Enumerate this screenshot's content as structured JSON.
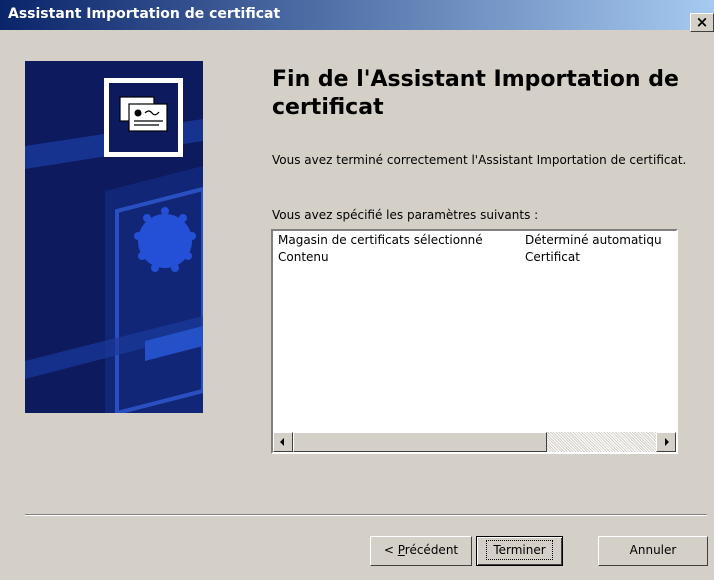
{
  "window": {
    "title": "Assistant Importation de certificat",
    "close_label": "×"
  },
  "content": {
    "heading": "Fin de l'Assistant Importation de certificat",
    "description": "Vous avez terminé correctement l'Assistant Importation de certificat.",
    "params_label": "Vous avez spécifié les paramètres suivants :"
  },
  "settings_list": {
    "rows": [
      {
        "name": "Magasin de certificats sélectionné",
        "value": "Déterminé automatiqu"
      },
      {
        "name": "Contenu",
        "value": "Certificat"
      }
    ]
  },
  "buttons": {
    "back_prefix": "< ",
    "back_mnemonic": "P",
    "back_rest": "récédent",
    "finish": "Terminer",
    "cancel": "Annuler"
  },
  "icons": {
    "banner": "certificate-card-icon",
    "scroll_left": "arrow-left-icon",
    "scroll_right": "arrow-right-icon"
  },
  "colors": {
    "titlebar_start": "#0a246a",
    "titlebar_end": "#a6caf0",
    "dialog_background": "#d4d0c8",
    "banner_background": "#0d1a5e"
  }
}
